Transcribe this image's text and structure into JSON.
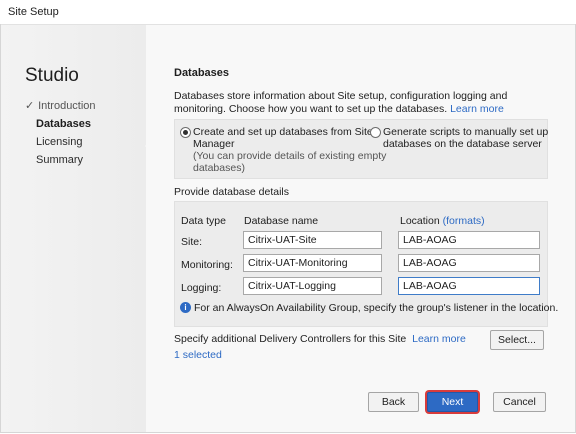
{
  "window": {
    "title": "Site Setup"
  },
  "sidebar": {
    "brand": "Studio",
    "steps": [
      {
        "label": "Introduction",
        "state": "done"
      },
      {
        "label": "Databases",
        "state": "active"
      },
      {
        "label": "Licensing",
        "state": "pending"
      },
      {
        "label": "Summary",
        "state": "pending"
      }
    ],
    "check_glyph": "✓"
  },
  "main": {
    "heading": "Databases",
    "intro": "Databases store information about Site setup, configuration logging and monitoring. Choose how you want to set up the databases.",
    "learn_more": "Learn more",
    "options": {
      "create": {
        "label_line1": "Create and set up databases from Site",
        "label_line2": "Manager",
        "sub_line1": "(You can provide details of existing empty",
        "sub_line2": "databases)",
        "selected": true
      },
      "scripts": {
        "label_line1": "Generate scripts to manually set up",
        "label_line2": "databases on the database server",
        "selected": false
      }
    },
    "details_label": "Provide database details",
    "columns": {
      "type": "Data type",
      "name": "Database name",
      "location": "Location",
      "formats_link": "(formats)"
    },
    "rows": [
      {
        "type": "Site:",
        "name": "Citrix-UAT-Site",
        "location": "LAB-AOAG"
      },
      {
        "type": "Monitoring:",
        "name": "Citrix-UAT-Monitoring",
        "location": "LAB-AOAG"
      },
      {
        "type": "Logging:",
        "name": "Citrix-UAT-Logging",
        "location": "LAB-AOAG"
      }
    ],
    "info_icon_glyph": "i",
    "info": "For an AlwaysOn Availability Group, specify the group's listener in the location.",
    "controllers_label": "Specify additional Delivery Controllers for this Site",
    "controllers_learn_more": "Learn more",
    "selected_count": "1 selected",
    "select_button": "Select..."
  },
  "footer": {
    "back": "Back",
    "next": "Next",
    "cancel": "Cancel"
  },
  "colors": {
    "accent": "#2d6ac4",
    "highlight": "#d83c3c"
  }
}
